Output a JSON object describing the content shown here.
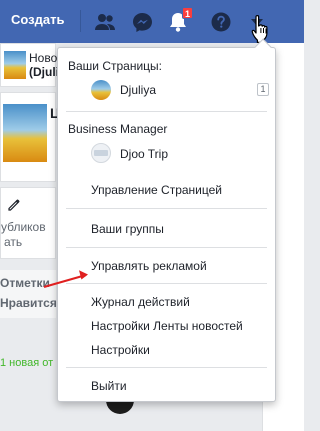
{
  "topbar": {
    "create_label": "Создать",
    "notification_count": "1",
    "icons": [
      "friends-icon",
      "messenger-icon",
      "bell-icon",
      "help-icon",
      "caret-icon"
    ]
  },
  "background": {
    "post1_line1": "Ново",
    "post1_line2": "(Djuli",
    "post2_line1": "Ц",
    "action_line1": "убликов",
    "action_line2": "ать",
    "gray_line1": "Отметки",
    "gray_line2": "Нравится:",
    "green_text": "1 новая от"
  },
  "dropdown": {
    "section_pages": "Ваши Страницы:",
    "page_djuliya": "Djuliya",
    "page_djuliya_count": "1",
    "section_business": "Business Manager",
    "page_djoo": "Djoo Trip",
    "manage_page": "Управление Страницей",
    "your_groups": "Ваши группы",
    "manage_ads": "Управлять рекламой",
    "activity_log": "Журнал действий",
    "news_feed_settings": "Настройки Ленты новостей",
    "settings": "Настройки",
    "logout": "Выйти"
  },
  "colors": {
    "topbar": "#4267b2",
    "badge": "#fa3e3e",
    "arrow": "#e02020",
    "green": "#42b72a"
  }
}
